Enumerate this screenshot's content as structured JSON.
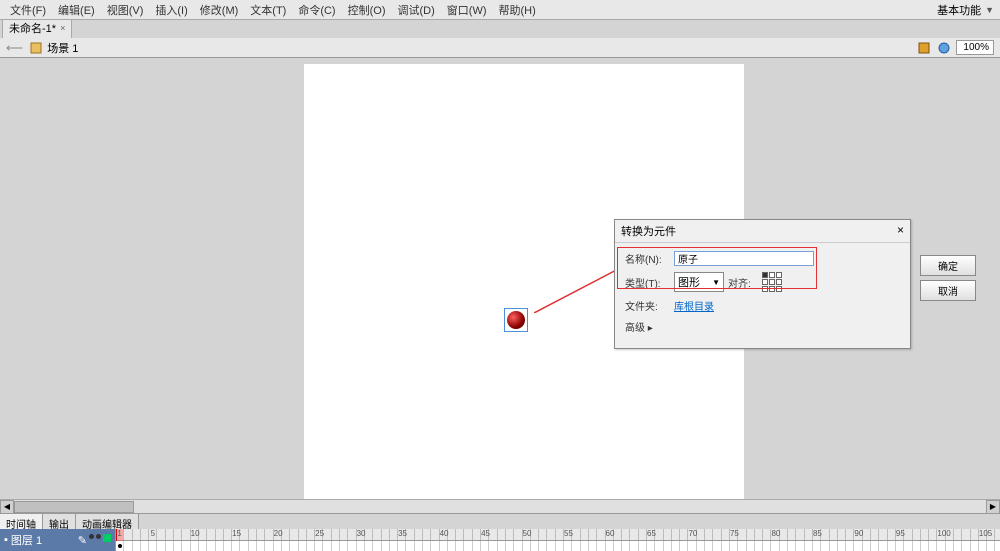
{
  "menubar": {
    "items": [
      "文件(F)",
      "编辑(E)",
      "视图(V)",
      "插入(I)",
      "修改(M)",
      "文本(T)",
      "命令(C)",
      "控制(O)",
      "调试(D)",
      "窗口(W)",
      "帮助(H)"
    ],
    "right_label": "基本功能"
  },
  "tab": {
    "title": "未命名-1*",
    "close": "×"
  },
  "scenebar": {
    "back": "⟵",
    "scene_label": "场景 1",
    "zoom": "100%"
  },
  "dialog": {
    "title": "转换为元件",
    "close": "×",
    "name_label": "名称(N):",
    "name_value": "原子",
    "type_label": "类型(T):",
    "type_value": "图形",
    "align_label": "对齐:",
    "folder_label": "文件夹:",
    "folder_link": "库根目录",
    "advanced": "高级 ▸",
    "ok": "确定",
    "cancel": "取消"
  },
  "timeline": {
    "tabs": [
      "时间轴",
      "输出",
      "动画编辑器"
    ],
    "layer_name": "图层 1",
    "ruler_step": 5
  }
}
